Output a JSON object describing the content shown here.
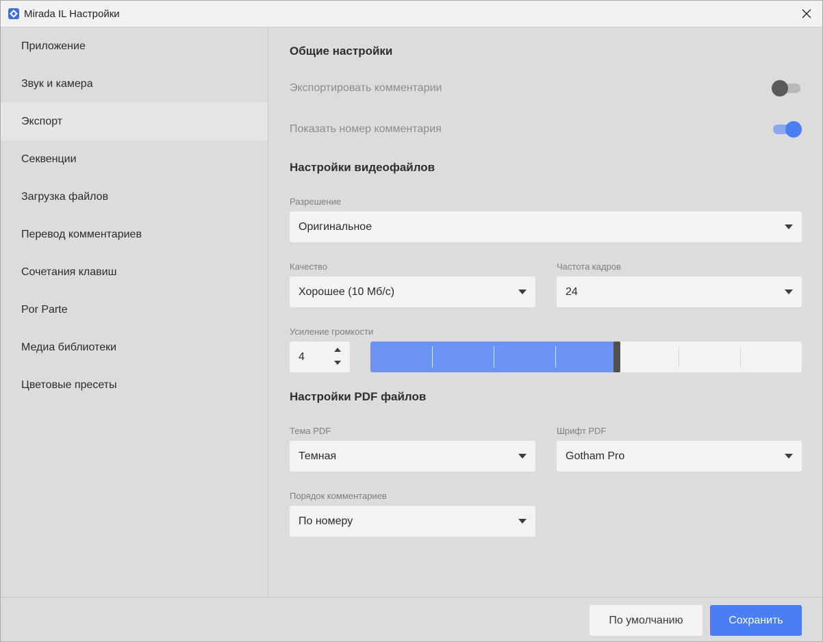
{
  "window": {
    "title": "Mirada IL Настройки"
  },
  "sidebar": {
    "items": [
      {
        "label": "Приложение"
      },
      {
        "label": "Звук и камера"
      },
      {
        "label": "Экспорт",
        "active": true
      },
      {
        "label": "Секвенции"
      },
      {
        "label": "Загрузка файлов"
      },
      {
        "label": "Перевод комментариев"
      },
      {
        "label": "Сочетания клавиш"
      },
      {
        "label": "Por Parte"
      },
      {
        "label": "Медиа библиотеки"
      },
      {
        "label": "Цветовые пресеты"
      }
    ]
  },
  "general": {
    "title": "Общие настройки",
    "export_comments": {
      "label": "Экспортировать комментарии",
      "enabled": false
    },
    "show_comment_number": {
      "label": "Показать номер комментария",
      "enabled": true
    }
  },
  "video": {
    "title": "Настройки видеофайлов",
    "resolution": {
      "label": "Разрешение",
      "value": "Оригинальное"
    },
    "quality": {
      "label": "Качество",
      "value": "Хорошее (10 Мб/с)"
    },
    "framerate": {
      "label": "Частота кадров",
      "value": "24"
    },
    "volume_boost": {
      "label": "Усиление громкости",
      "value": "4",
      "level": 4,
      "min": 1,
      "max": 8
    }
  },
  "pdf": {
    "title": "Настройки PDF файлов",
    "theme": {
      "label": "Тема PDF",
      "value": "Темная"
    },
    "font": {
      "label": "Шрифт PDF",
      "value": "Gotham Pro"
    },
    "comment_order": {
      "label": "Порядок комментариев",
      "value": "По номеру"
    }
  },
  "footer": {
    "default_label": "По умолчанию",
    "save_label": "Сохранить"
  },
  "colors": {
    "accent": "#4a7ff3",
    "slider_fill": "#6a93f5",
    "background": "#dcdcdc",
    "field": "#f3f3f3"
  }
}
